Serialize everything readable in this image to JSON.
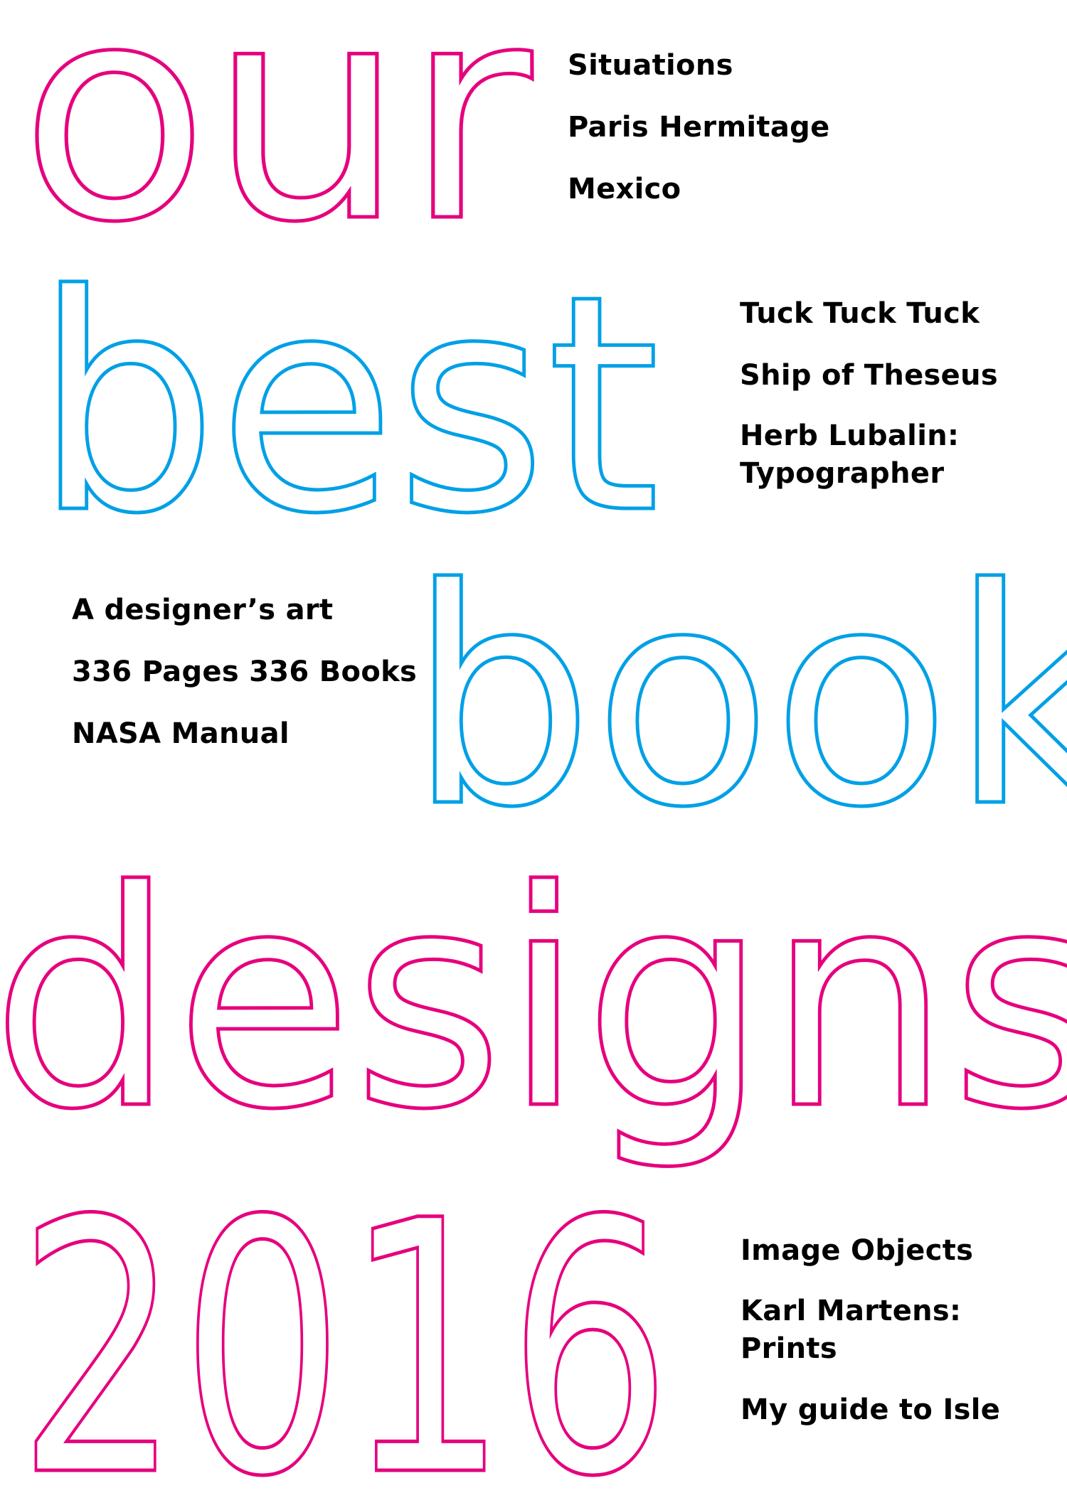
{
  "colors": {
    "background": "#ffffff",
    "magenta": "#e6007e",
    "cyan": "#00a0e6",
    "text": "#000000"
  },
  "headline": {
    "word_1": "our",
    "word_2": "best",
    "word_3": "book",
    "word_4": "designs",
    "word_5": "2016"
  },
  "title_groups": [
    {
      "items": [
        "Situations",
        "Paris Hermitage",
        "Mexico"
      ]
    },
    {
      "items": [
        "Tuck Tuck Tuck",
        "Ship of Theseus",
        "Herb Lubalin:\nTypographer"
      ]
    },
    {
      "items": [
        "A designer’s art",
        "336 Pages 336 Books",
        "NASA Manual"
      ]
    },
    {
      "items": [
        "Image Objects",
        "Karl Martens:\nPrints",
        "My guide to Isle"
      ]
    }
  ]
}
